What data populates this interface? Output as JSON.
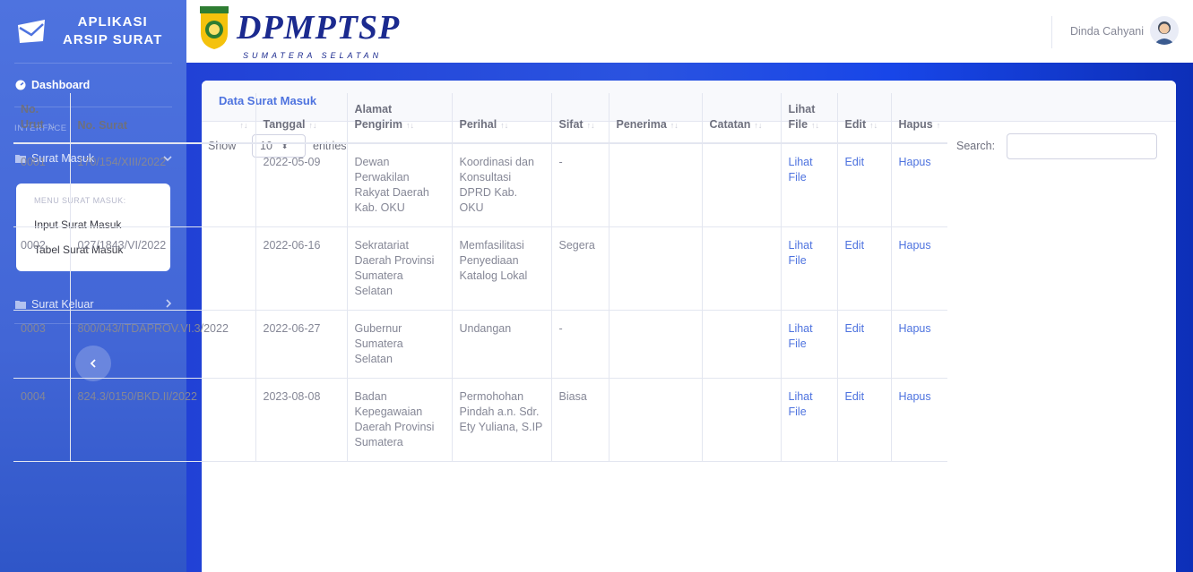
{
  "sidebar": {
    "brand_line1": "APLIKASI",
    "brand_line2": "ARSIP SURAT",
    "dashboard_label": "Dashboard",
    "heading": "INTERFACE",
    "surat_masuk_label": "Surat Masuk",
    "submenu_heading": "MENU SURAT MASUK:",
    "submenu_items": [
      "Input Surat Masuk",
      "Tabel Surat Masuk"
    ],
    "surat_keluar_label": "Surat Keluar"
  },
  "topbar": {
    "logo_text": "DPMPTSP",
    "logo_sub": "SUMATERA SELATAN",
    "user_name": "Dinda Cahyani"
  },
  "card": {
    "title": "Data Surat Masuk",
    "show_label": "Show",
    "show_value": "10",
    "entries_label": "entries",
    "search_label": "Search:"
  },
  "table": {
    "headers": [
      "No. Urut",
      "No. Surat",
      "Tanggal",
      "Alamat Pengirim",
      "Perihal",
      "Sifat",
      "Penerima",
      "Catatan",
      "Lihat File",
      "Edit",
      "Hapus"
    ],
    "rows": [
      [
        "0001",
        "170/154/XIII/2022",
        "2022-05-09",
        "Dewan Perwakilan Rakyat Daerah Kab. OKU",
        "Koordinasi dan Konsultasi DPRD Kab. OKU",
        "-",
        "",
        "",
        "Lihat File",
        "Edit",
        "Hapus"
      ],
      [
        "0002",
        "027/1843/VI/2022",
        "2022-06-16",
        "Sekratariat Daerah Provinsi Sumatera Selatan",
        "Memfasilitasi Penyediaan Katalog Lokal",
        "Segera",
        "",
        "",
        "Lihat File",
        "Edit",
        "Hapus"
      ],
      [
        "0003",
        "800/043/ITDAPROV.VI.3/2022",
        "2022-06-27",
        "Gubernur Sumatera Selatan",
        "Undangan",
        "-",
        "",
        "",
        "Lihat File",
        "Edit",
        "Hapus"
      ],
      [
        "0004",
        "824.3/0150/BKD.II/2022",
        "2023-08-08",
        "Badan Kepegawaian Daerah Provinsi Sumatera",
        "Permohohan Pindah a.n. Sdr. Ety Yuliana, S.IP",
        "Biasa",
        "",
        "",
        "Lihat File",
        "Edit",
        "Hapus"
      ]
    ]
  },
  "colors": {
    "primary": "#4e73df",
    "sidebar_bg": "#4e73df",
    "text_muted": "#858796"
  },
  "icons": {
    "brand": "envelope-icon",
    "dashboard": "tachometer-icon",
    "folder": "folder-icon",
    "chevron_down": "chevron-down-icon",
    "chevron_right": "chevron-right-icon",
    "toggle": "chevron-left-icon"
  }
}
